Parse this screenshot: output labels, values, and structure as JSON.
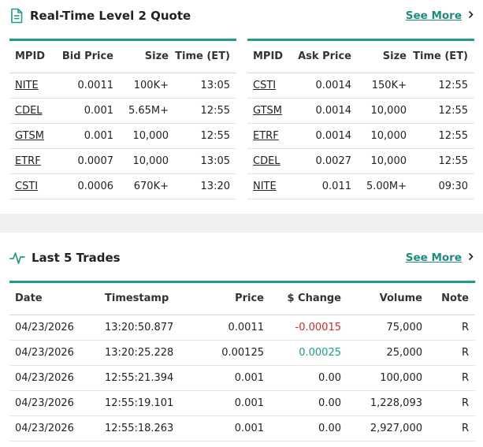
{
  "level2": {
    "title": "Real-Time Level 2 Quote",
    "see_more": "See More",
    "bid": {
      "headers": [
        "MPID",
        "Bid Price",
        "Size",
        "Time (ET)"
      ],
      "rows": [
        [
          "NITE",
          "0.0011",
          "100K+",
          "13:05"
        ],
        [
          "CDEL",
          "0.001",
          "5.65M+",
          "12:55"
        ],
        [
          "GTSM",
          "0.001",
          "10,000",
          "12:55"
        ],
        [
          "ETRF",
          "0.0007",
          "10,000",
          "13:05"
        ],
        [
          "CSTI",
          "0.0006",
          "670K+",
          "13:20"
        ]
      ]
    },
    "ask": {
      "headers": [
        "MPID",
        "Ask Price",
        "Size",
        "Time (ET)"
      ],
      "rows": [
        [
          "CSTI",
          "0.0014",
          "150K+",
          "12:55"
        ],
        [
          "GTSM",
          "0.0014",
          "10,000",
          "12:55"
        ],
        [
          "ETRF",
          "0.0014",
          "10,000",
          "12:55"
        ],
        [
          "CDEL",
          "0.0027",
          "10,000",
          "12:55"
        ],
        [
          "NITE",
          "0.011",
          "5.00M+",
          "09:30"
        ]
      ]
    }
  },
  "trades": {
    "title": "Last 5 Trades",
    "see_more": "See More",
    "headers": [
      "Date",
      "Timestamp",
      "Price",
      "$ Change",
      "Volume",
      "Note"
    ],
    "rows": [
      [
        "04/23/2026",
        "13:20:50.877",
        "0.0011",
        "-0.00015",
        "75,000",
        "R"
      ],
      [
        "04/23/2026",
        "13:20:25.228",
        "0.00125",
        "0.00025",
        "25,000",
        "R"
      ],
      [
        "04/23/2026",
        "12:55:21.394",
        "0.001",
        "0.00",
        "100,000",
        "R"
      ],
      [
        "04/23/2026",
        "12:55:19.101",
        "0.001",
        "0.00",
        "1,228,093",
        "R"
      ],
      [
        "04/23/2026",
        "12:55:18.263",
        "0.001",
        "0.00",
        "2,927,000",
        "R"
      ]
    ]
  },
  "colors": {
    "accent": "#1e9e8a",
    "link": "#1a8d7c",
    "negative": "#d22b2b",
    "positive": "#1a9e88"
  },
  "icons": {
    "level2": "document-icon",
    "trades": "pulse-icon",
    "see_more": "chevron-right-icon"
  }
}
